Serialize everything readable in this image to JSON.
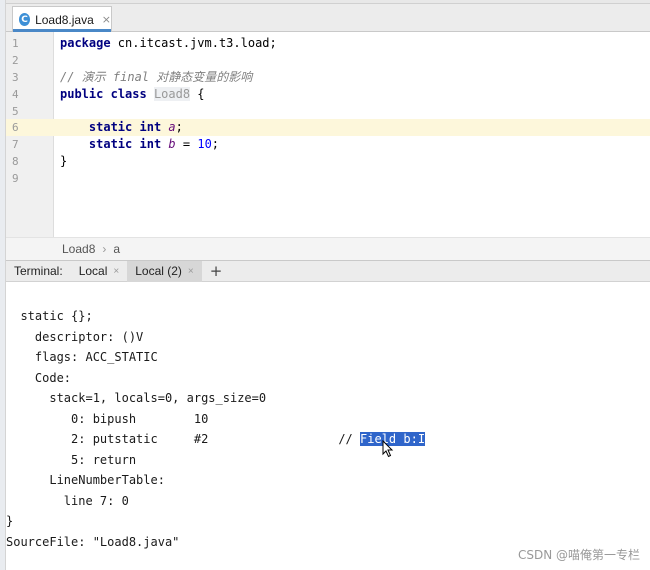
{
  "editor_tab": {
    "filename": "Load8.java",
    "icon": "java-class-icon",
    "close": "×"
  },
  "code_lines": [
    {
      "num": "1"
    },
    {
      "num": "2"
    },
    {
      "num": "3"
    },
    {
      "num": "4"
    },
    {
      "num": "5"
    },
    {
      "num": "6"
    },
    {
      "num": "7"
    },
    {
      "num": "8"
    },
    {
      "num": "9"
    }
  ],
  "code": {
    "l1_kw": "package",
    "l1_rest": " cn.itcast.jvm.t3.load;",
    "l3_comment": "// 演示 final 对静态变量的影响",
    "l4_kw1": "public",
    "l4_kw2": "class",
    "l4_cls": "Load8",
    "l4_brace": " {",
    "l6_kw1": "static",
    "l6_kw2": "int",
    "l6_field": "a",
    "l6_end": ";",
    "l7_kw1": "static",
    "l7_kw2": "int",
    "l7_field": "b",
    "l7_eq": " = ",
    "l7_num": "10",
    "l7_end": ";",
    "l8_brace": "}"
  },
  "breadcrumb": {
    "class": "Load8",
    "sep": "›",
    "member": "a"
  },
  "terminal_bar": {
    "label": "Terminal:",
    "tabs": [
      {
        "label": "Local"
      },
      {
        "label": "Local (2)"
      }
    ],
    "close": "×",
    "plus": "+"
  },
  "terminal_lines": [
    "  static {};",
    "    descriptor: ()V",
    "    flags: ACC_STATIC",
    "    Code:",
    "      stack=1, locals=0, args_size=0",
    "         0: bipush        10",
    "         2: putstatic     #2                  // ",
    "         5: return",
    "      LineNumberTable:",
    "        line 7: 0",
    "}",
    "SourceFile: \"Load8.java\""
  ],
  "terminal_selection": "Field b:I",
  "watermark": "CSDN @喵俺第一专栏",
  "colors": {
    "selection": "#2f65ca",
    "keyword": "#000080",
    "field": "#660e7a",
    "number": "#0000ff"
  }
}
